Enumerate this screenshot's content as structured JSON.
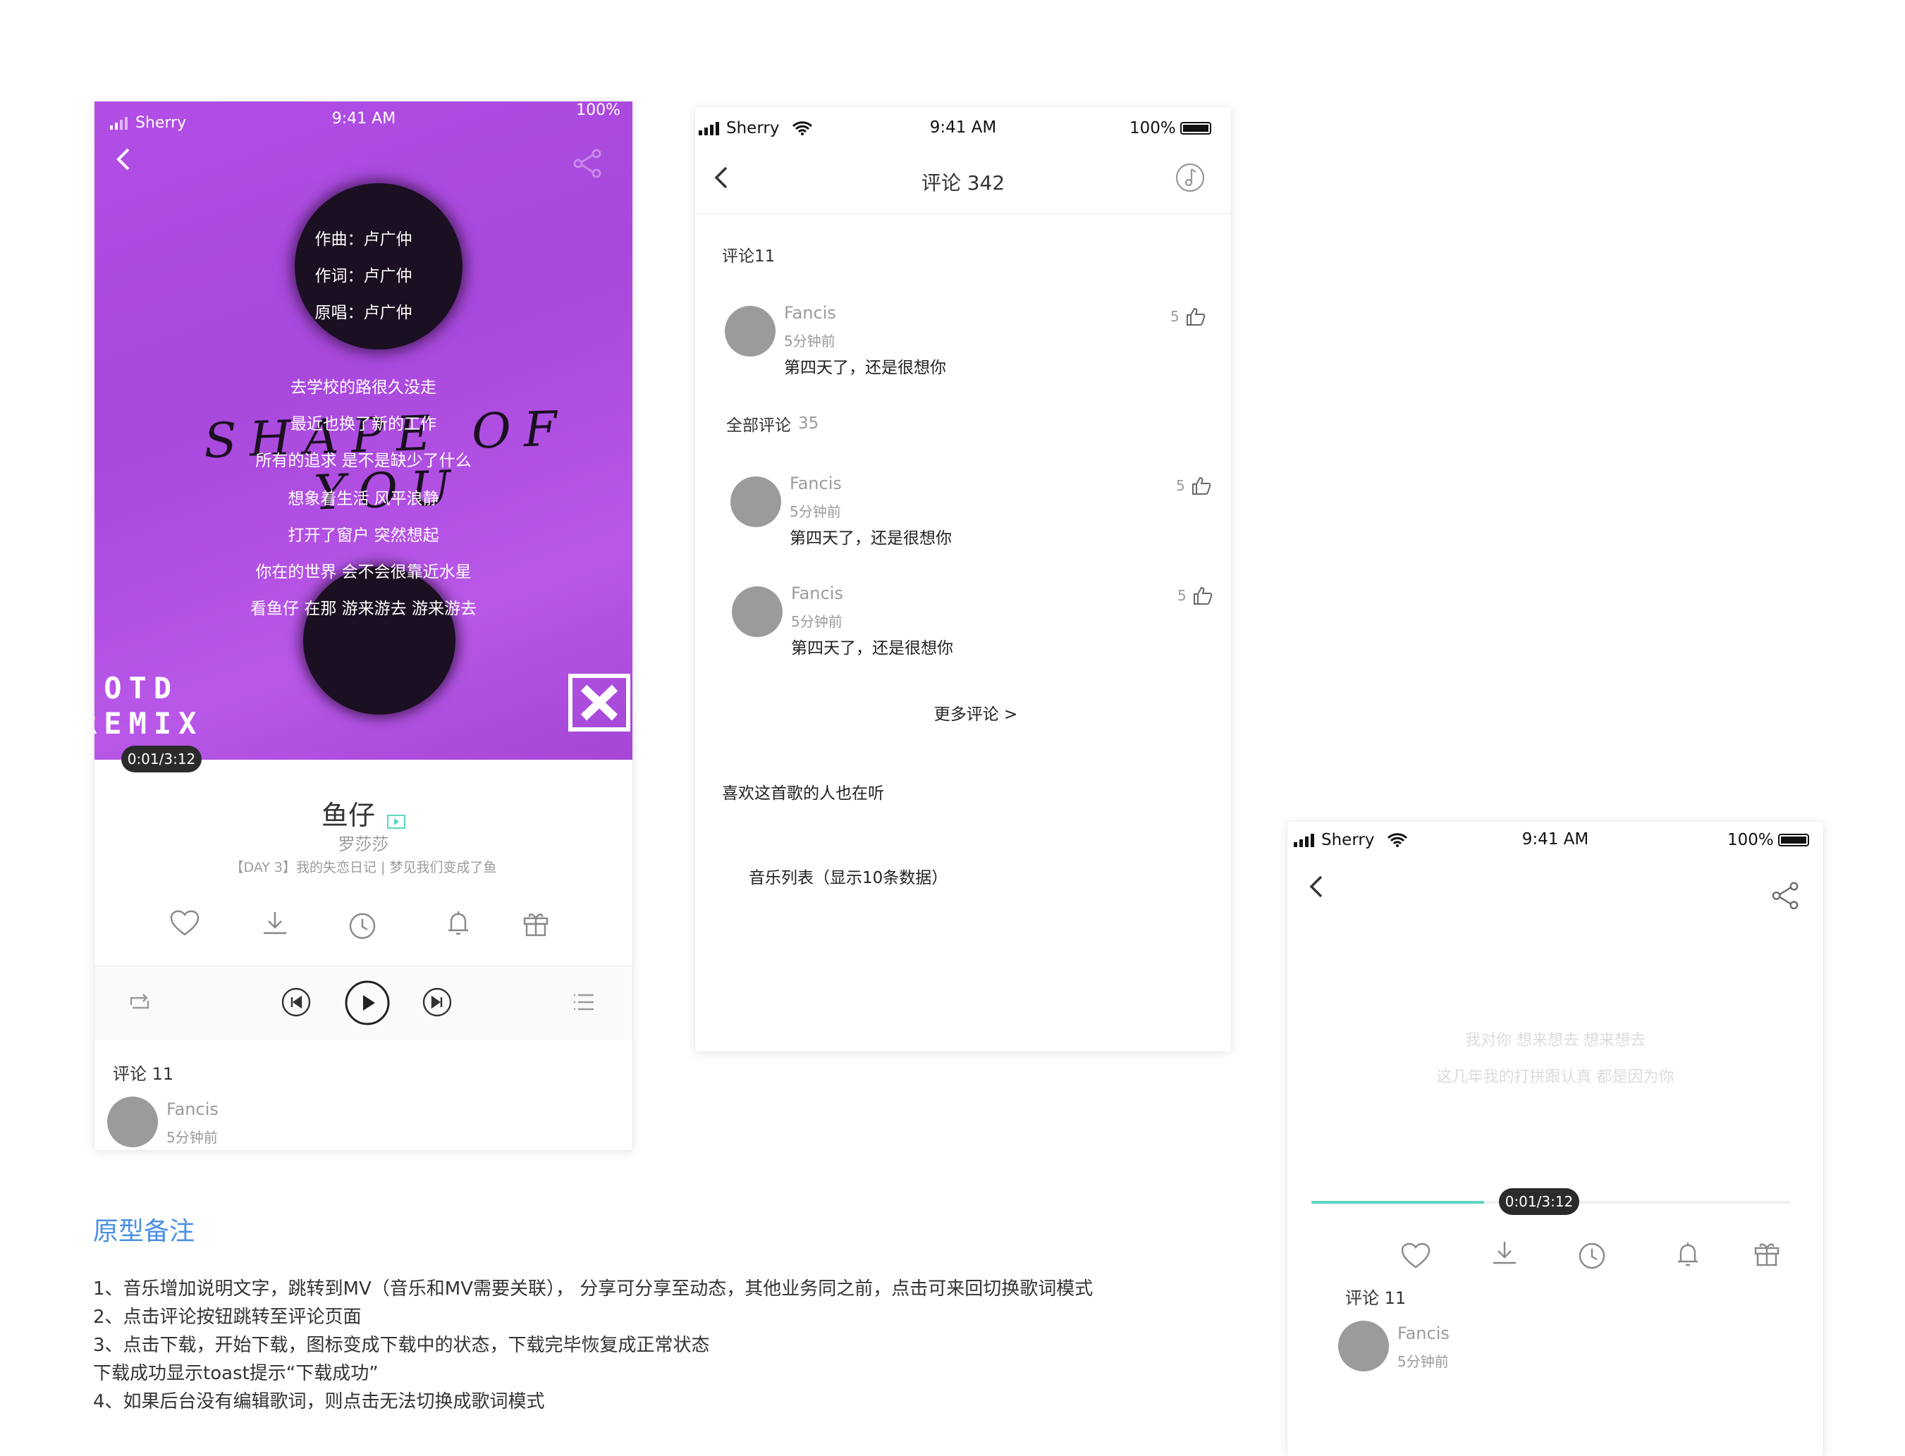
{
  "screen1": {
    "status": {
      "carrier": "Sherry",
      "time": "9:41 AM",
      "battery": "100%"
    },
    "credits": [
      "作曲：卢广仲",
      "作词：卢广仲",
      "原唱：卢广仲"
    ],
    "art_title": "SHAPE OF YOU",
    "art_corner_text": [
      "IOTD",
      "REMIX"
    ],
    "lyrics": [
      "去学校的路很久没走",
      "最近也换了新的工作",
      "所有的追求 是不是缺少了什么",
      "想象着生活 风平浪静",
      "打开了窗户 突然想起",
      "你在的世界 会不会很靠近水星",
      "看鱼仔 在那 游来游去 游来游去"
    ],
    "time_badge": "0:01/3:12",
    "song_title": "鱼仔",
    "artist": "罗莎莎",
    "description": "【DAY 3】我的失恋日记 | 梦见我们变成了鱼",
    "comments_title": "评论 11",
    "comment": {
      "user": "Fancis",
      "time": "5分钟前"
    },
    "mv_badge_color": "#5fd5c0",
    "art_color": "#b14de0"
  },
  "screen2": {
    "status": {
      "carrier": "Sherry",
      "time": "9:41 AM",
      "battery": "100%"
    },
    "nav_title": "评论 342",
    "hot_section": "评论11",
    "hot_comment": {
      "user": "Fancis",
      "time": "5分钟前",
      "text": "第四天了，还是很想你",
      "likes": "5"
    },
    "all_section": "全部评论",
    "all_count": "35",
    "comments": [
      {
        "user": "Fancis",
        "time": "5分钟前",
        "text": "第四天了，还是很想你",
        "likes": "5"
      },
      {
        "user": "Fancis",
        "time": "5分钟前",
        "text": "第四天了，还是很想你",
        "likes": "5"
      }
    ],
    "more": "更多评论 >",
    "also_listening": "喜欢这首歌的人也在听",
    "music_list": "音乐列表（显示10条数据）"
  },
  "screen3": {
    "status": {
      "carrier": "Sherry",
      "time": "9:41 AM",
      "battery": "100%"
    },
    "lyrics": [
      "我对你 想来想去 想来想去",
      "这几年我的打拼跟认真 都是因为你"
    ],
    "time_badge": "0:01/3:12",
    "progress": 0.36,
    "progress_color": "#5fd5c0",
    "comments_title": "评论 11",
    "comment": {
      "user": "Fancis",
      "time": "5分钟前"
    }
  },
  "notes": {
    "title": "原型备注",
    "title_color": "#4a90e2",
    "lines": [
      "1、音乐增加说明文字，跳转到MV（音乐和MV需要关联）， 分享可分享至动态，其他业务同之前，点击可来回切换歌词模式",
      "2、点击评论按钮跳转至评论页面",
      "3、点击下载，开始下载，图标变成下载中的状态，下载完毕恢复成正常状态",
      "下载成功显示toast提示“下载成功”",
      "4、如果后台没有编辑歌词，则点击无法切换成歌词模式"
    ]
  }
}
